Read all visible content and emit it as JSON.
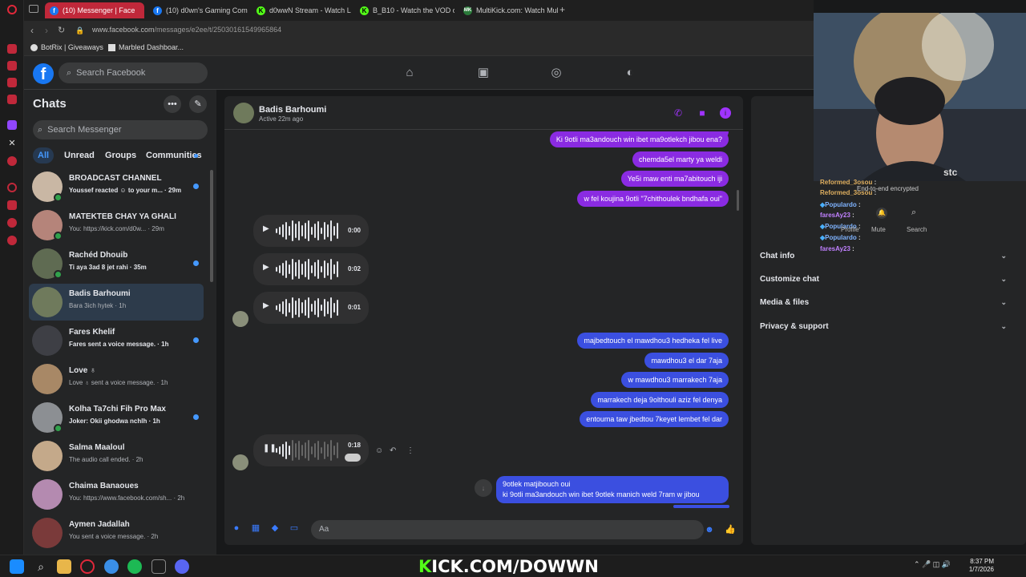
{
  "browser": {
    "tabs": [
      {
        "label": "(10) Messenger | Face",
        "active": true,
        "color": "#1877f2"
      },
      {
        "label": "(10) d0wn's Gaming Com",
        "active": false,
        "color": "#1877f2"
      },
      {
        "label": "d0wwN Stream - Watch L",
        "active": false,
        "color": "#53fc18"
      },
      {
        "label": "B_B10 - Watch the VOD on",
        "active": false,
        "color": "#53fc18"
      },
      {
        "label": "MultiKick.com: Watch Mult",
        "active": false,
        "color": "#2a7a3a"
      }
    ],
    "new_tab_label": "+",
    "url_host": "www.facebook.com",
    "url_path": "/messages/e2ee/t/25030161549965864",
    "bookmarks": [
      "BotRix | Giveaways",
      "Marbled Dashboar..."
    ]
  },
  "fb": {
    "logo": "f",
    "search_placeholder": "Search Facebook"
  },
  "chats": {
    "title": "Chats",
    "search_placeholder": "Search Messenger",
    "filters": [
      "All",
      "Unread",
      "Groups",
      "Communities"
    ],
    "items": [
      {
        "name": "BROADCAST CHANNEL",
        "preview": "Youssef reacted ☺ to your m... · 29m",
        "unread": true,
        "online": true,
        "color": "#c9b7a4"
      },
      {
        "name": "MATEKTEB CHAY YA GHALI",
        "preview": "You: https://kick.com/d0w... · 29m",
        "unread": false,
        "online": true,
        "color": "#b5847a"
      },
      {
        "name": "Rachéd Dhouib",
        "preview": "Ti aya 3ad 8 jet rahi · 35m",
        "unread": true,
        "online": true,
        "color": "#5f6b52"
      },
      {
        "name": "Badis Barhoumi",
        "preview": "Bara 3ich hytek · 1h",
        "unread": false,
        "online": false,
        "color": "#6f7a5c"
      },
      {
        "name": "Fares Khelif",
        "preview": "Fares sent a voice message. · 1h",
        "unread": true,
        "online": false,
        "color": "#3e3f45"
      },
      {
        "name": "Love ♁",
        "preview": "Love ♁ sent a voice message. · 1h",
        "unread": false,
        "online": false,
        "color": "#a88866"
      },
      {
        "name": "Kolha Ta7chi Fih Pro Max",
        "preview": "Joker: Okii ghodwa nchlh · 1h",
        "unread": true,
        "online": true,
        "color": "#8c8f93"
      },
      {
        "name": "Salma Maaloul",
        "preview": "The audio call ended. · 2h",
        "unread": false,
        "online": false,
        "color": "#c4a98a"
      },
      {
        "name": "Chaima Banaoues",
        "preview": "You: https://www.facebook.com/sh... · 2h",
        "unread": false,
        "online": false,
        "color": "#b48ab0"
      },
      {
        "name": "Aymen Jadallah",
        "preview": "You sent a voice message. · 2h",
        "unread": false,
        "online": false,
        "color": "#7a3a3a"
      }
    ]
  },
  "conversation": {
    "name": "Badis Barhoumi",
    "status": "Active 22m ago",
    "messages_top": [
      "Ki 9otli ma3andouch win ibet ma9otlekch jibou ena?",
      "chemda5el marty ya weldi",
      "Ye5i maw enti ma7abitouch iji",
      "w fel koujina 9otli \"7chithoulek bndhafa oui\""
    ],
    "voice_messages": [
      "0:00",
      "0:02",
      "0:01"
    ],
    "messages_mid": [
      "majbedtouch el mawdhou3 hedheka fel live",
      "mawdhou3 el dar 7aja",
      "w mawdhou3 marrakech 7aja",
      "marrakech deja 9olthouli aziz fel denya",
      "entouma taw jbedtou 7keyet lembet fel dar"
    ],
    "playing_voice": "0:18",
    "last_message": [
      "9otlek matjibouch oui",
      "ki 9otli ma3andouch win ibet 9otlek manich weld 7ram w jibou"
    ],
    "composer_placeholder": "Aa"
  },
  "info_panel": {
    "sections": [
      "Chat info",
      "Customize chat",
      "Media & files",
      "Privacy & support"
    ],
    "encrypted_note": "End-to-end encrypted",
    "actions": [
      "Profile",
      "Mute",
      "Search"
    ]
  },
  "stream_chat": [
    {
      "user": "Reformed_3osou",
      "color": "#e0b060"
    },
    {
      "user": "Reformed_3osou",
      "color": "#e0b060"
    },
    {
      "user": "Populardo",
      "color": "#7fb3ff"
    },
    {
      "user": "faresAy23",
      "color": "#c080ff"
    },
    {
      "user": "Populardo",
      "color": "#7fb3ff"
    },
    {
      "user": "Populardo",
      "color": "#7fb3ff"
    },
    {
      "user": "faresAy23",
      "color": "#c080ff"
    }
  ],
  "taskbar": {
    "banner": "KICK.COM/DOWWN",
    "time": "8:37 PM",
    "date": "1/7/2026"
  },
  "colors": {
    "accent_purple": "#8a2be2",
    "accent_blue": "#3b4fe0",
    "fb_blue": "#1877f2",
    "kick_green": "#53fc18"
  }
}
